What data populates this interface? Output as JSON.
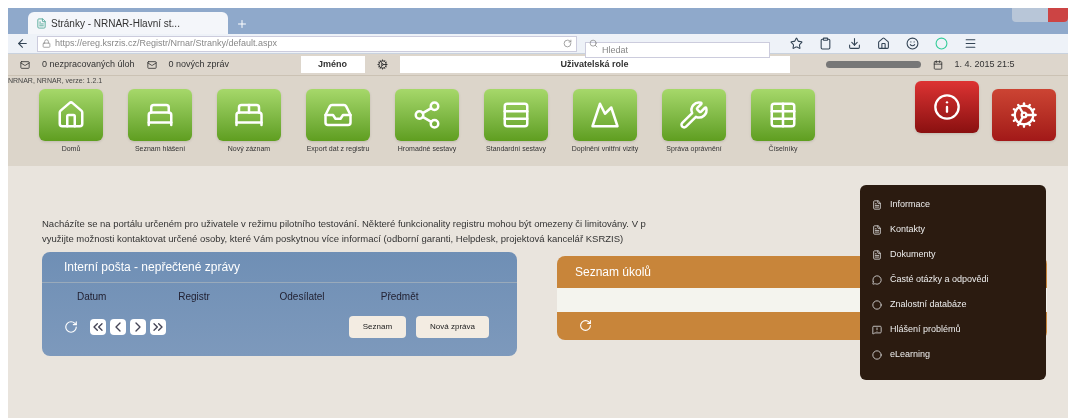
{
  "browser": {
    "tab_title": "Stránky - NRNAR-Hlavní st...",
    "url": "https://ereg.ksrzis.cz/Registr/Nrnar/Stranky/default.aspx",
    "search": {
      "placeholder": "Hledat"
    }
  },
  "toolbar": {
    "tasks": "0 nezpracovaných úloh",
    "messages": "0 nových zpráv",
    "name": "Jméno",
    "role": "Uživatelská role",
    "datetime": "1. 4. 2015 21:5"
  },
  "version": "NRNAR, NRNAR, verze: 1.2.1",
  "tiles": [
    {
      "kind": "home",
      "label": "Domů"
    },
    {
      "kind": "patient",
      "label": "Seznam hlášení"
    },
    {
      "kind": "patient-new",
      "label": "Nový záznam"
    },
    {
      "kind": "export",
      "label": "Export dat z registru"
    },
    {
      "kind": "share",
      "label": "Hromadné sestavy"
    },
    {
      "kind": "list",
      "label": "Standardní sestavy"
    },
    {
      "kind": "mountain",
      "label": "Doplnění vnitřní vizity"
    },
    {
      "kind": "tools",
      "label": "Správa oprávnění"
    },
    {
      "kind": "table",
      "label": "Číselníky"
    }
  ],
  "actions": [
    {
      "kind": "info",
      "expanded": true
    },
    {
      "kind": "settings",
      "expanded": false
    }
  ],
  "intro": [
    "Nacházíte se na portálu určeném pro uživatele v režimu pilotního testování. Některé funkcionality registru mohou být omezeny či limitovány. V p",
    "využijte možnosti kontaktovat určené osoby, které Vám poskytnou více informací (odborní garanti, Helpdesk, projektová kancelář KSRZIS)"
  ],
  "mail": {
    "title": "Interní pošta - nepřečtené zprávy",
    "columns": [
      "Datum",
      "Registr",
      "Odesílatel",
      "Předmět"
    ],
    "buttons": [
      "Seznam",
      "Nová zpráva"
    ]
  },
  "tasks": {
    "title": "Seznam úkolů"
  },
  "menu": [
    {
      "kind": "doc",
      "label": "Informace"
    },
    {
      "kind": "doc",
      "label": "Kontakty"
    },
    {
      "kind": "doc",
      "label": "Dokumenty"
    },
    {
      "kind": "bubble",
      "label": "Časté otázky a odpovědi"
    },
    {
      "kind": "ring",
      "label": "Znalostní databáze"
    },
    {
      "kind": "alert",
      "label": "Hlášení problémů"
    },
    {
      "kind": "ring",
      "label": "eLearning"
    }
  ]
}
